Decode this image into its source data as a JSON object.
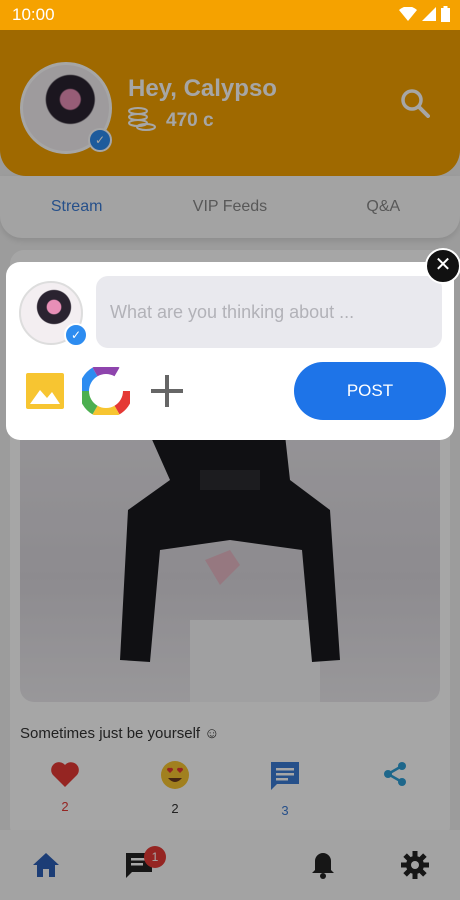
{
  "status_bar": {
    "time": "10:00"
  },
  "header": {
    "greeting": "Hey,  Calypso",
    "coins": "470 c"
  },
  "tabs": [
    {
      "label": "Stream",
      "active": true
    },
    {
      "label": "VIP Feeds",
      "active": false
    },
    {
      "label": "Q&A",
      "active": false
    }
  ],
  "post": {
    "caption": "Sometimes just be yourself ☺",
    "reactions": [
      {
        "icon": "heart-icon",
        "count": "2",
        "color": "#e53935"
      },
      {
        "icon": "heart-eyes-emoji-icon",
        "count": "2",
        "color": "#333333"
      },
      {
        "icon": "comment-icon",
        "count": "3",
        "color": "#3b7bd4"
      },
      {
        "icon": "share-icon",
        "count": "",
        "color": "#2f9fd6"
      }
    ]
  },
  "bottom_nav": {
    "messages_badge": "1"
  },
  "compose": {
    "placeholder": "What are you thinking about ...",
    "post_label": "POST",
    "close_label": "✕"
  },
  "colors": {
    "brand": "#f5a200",
    "accent": "#1e74e8"
  }
}
